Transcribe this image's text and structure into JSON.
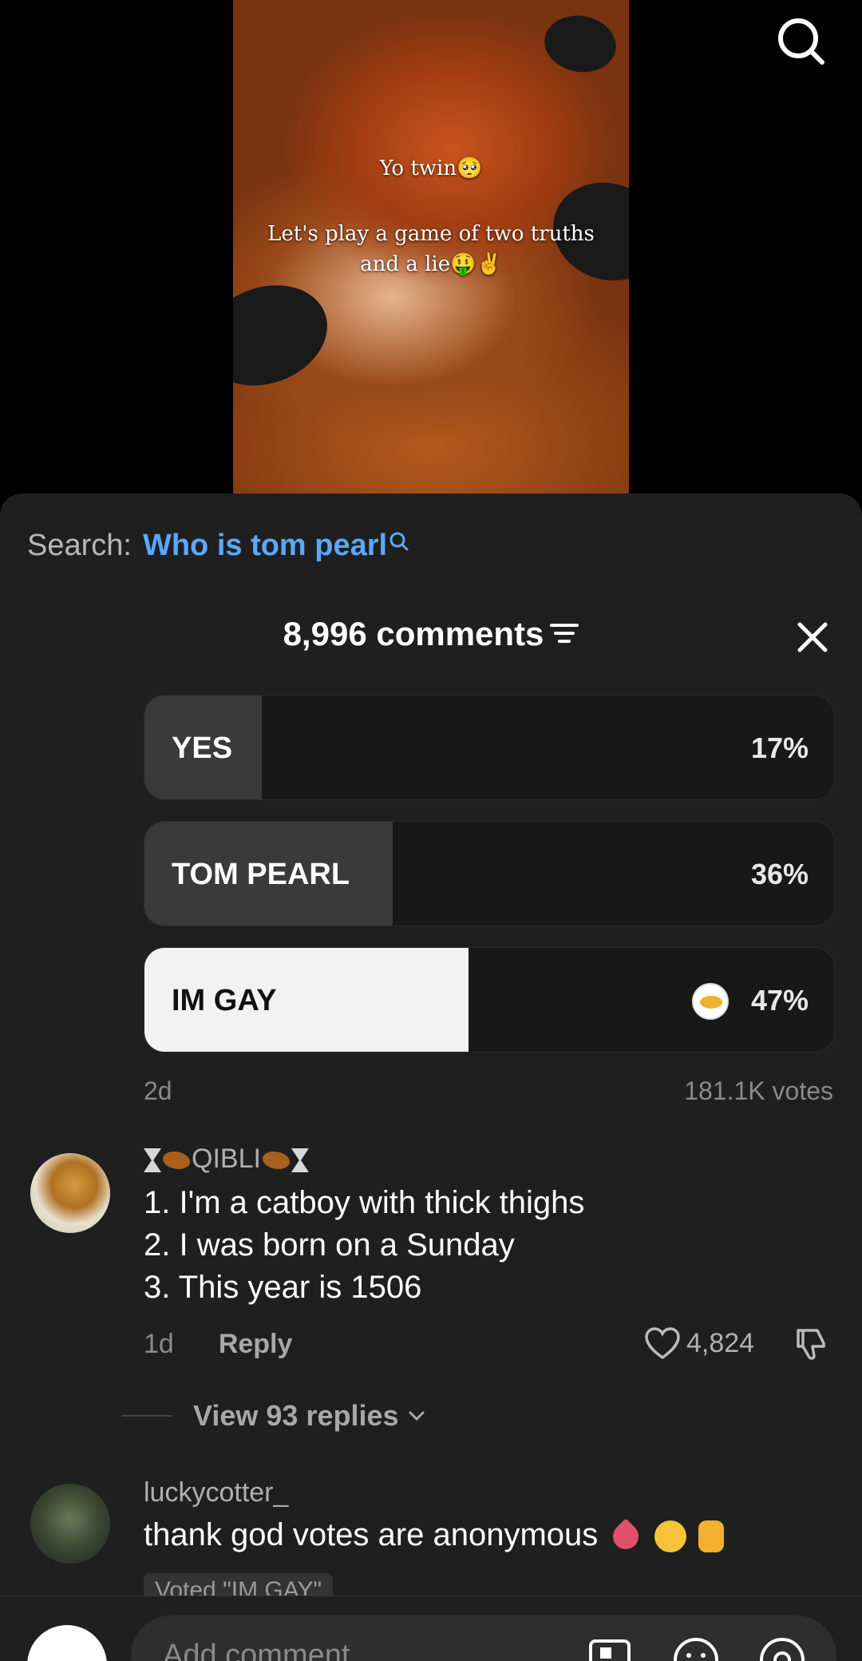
{
  "video": {
    "caption_line1": "Yo twin🥺",
    "caption_line2": "Let's play a game of two truths and a lie🤑✌️"
  },
  "search_suggestion": {
    "label": "Search:",
    "query": "Who is tom pearl"
  },
  "comments_header": {
    "title": "8,996 comments"
  },
  "poll": {
    "options": [
      {
        "label": "YES",
        "percent_text": "17%",
        "percent": 17,
        "selected": false
      },
      {
        "label": "TOM PEARL",
        "percent_text": "36%",
        "percent": 36,
        "selected": false
      },
      {
        "label": "IM GAY",
        "percent_text": "47%",
        "percent": 47,
        "selected": true
      }
    ],
    "age": "2d",
    "votes": "181.1K votes"
  },
  "comments": [
    {
      "username": "QIBLI",
      "lines": [
        "1. I'm a catboy with thick thighs",
        "2. I was born on a Sunday",
        "3. This year is 1506"
      ],
      "age": "1d",
      "reply_label": "Reply",
      "likes": "4,824",
      "view_replies": "View 93 replies"
    },
    {
      "username": "luckycotter_",
      "text": "thank god votes are anonymous",
      "voted_tag": "Voted \"IM GAY\""
    }
  ],
  "composer": {
    "placeholder": "Add comment..."
  },
  "colors": {
    "accent_link": "#5aa8ff",
    "sheet_bg": "#1f1f1f",
    "poll_selected": "#f2f2f2"
  }
}
